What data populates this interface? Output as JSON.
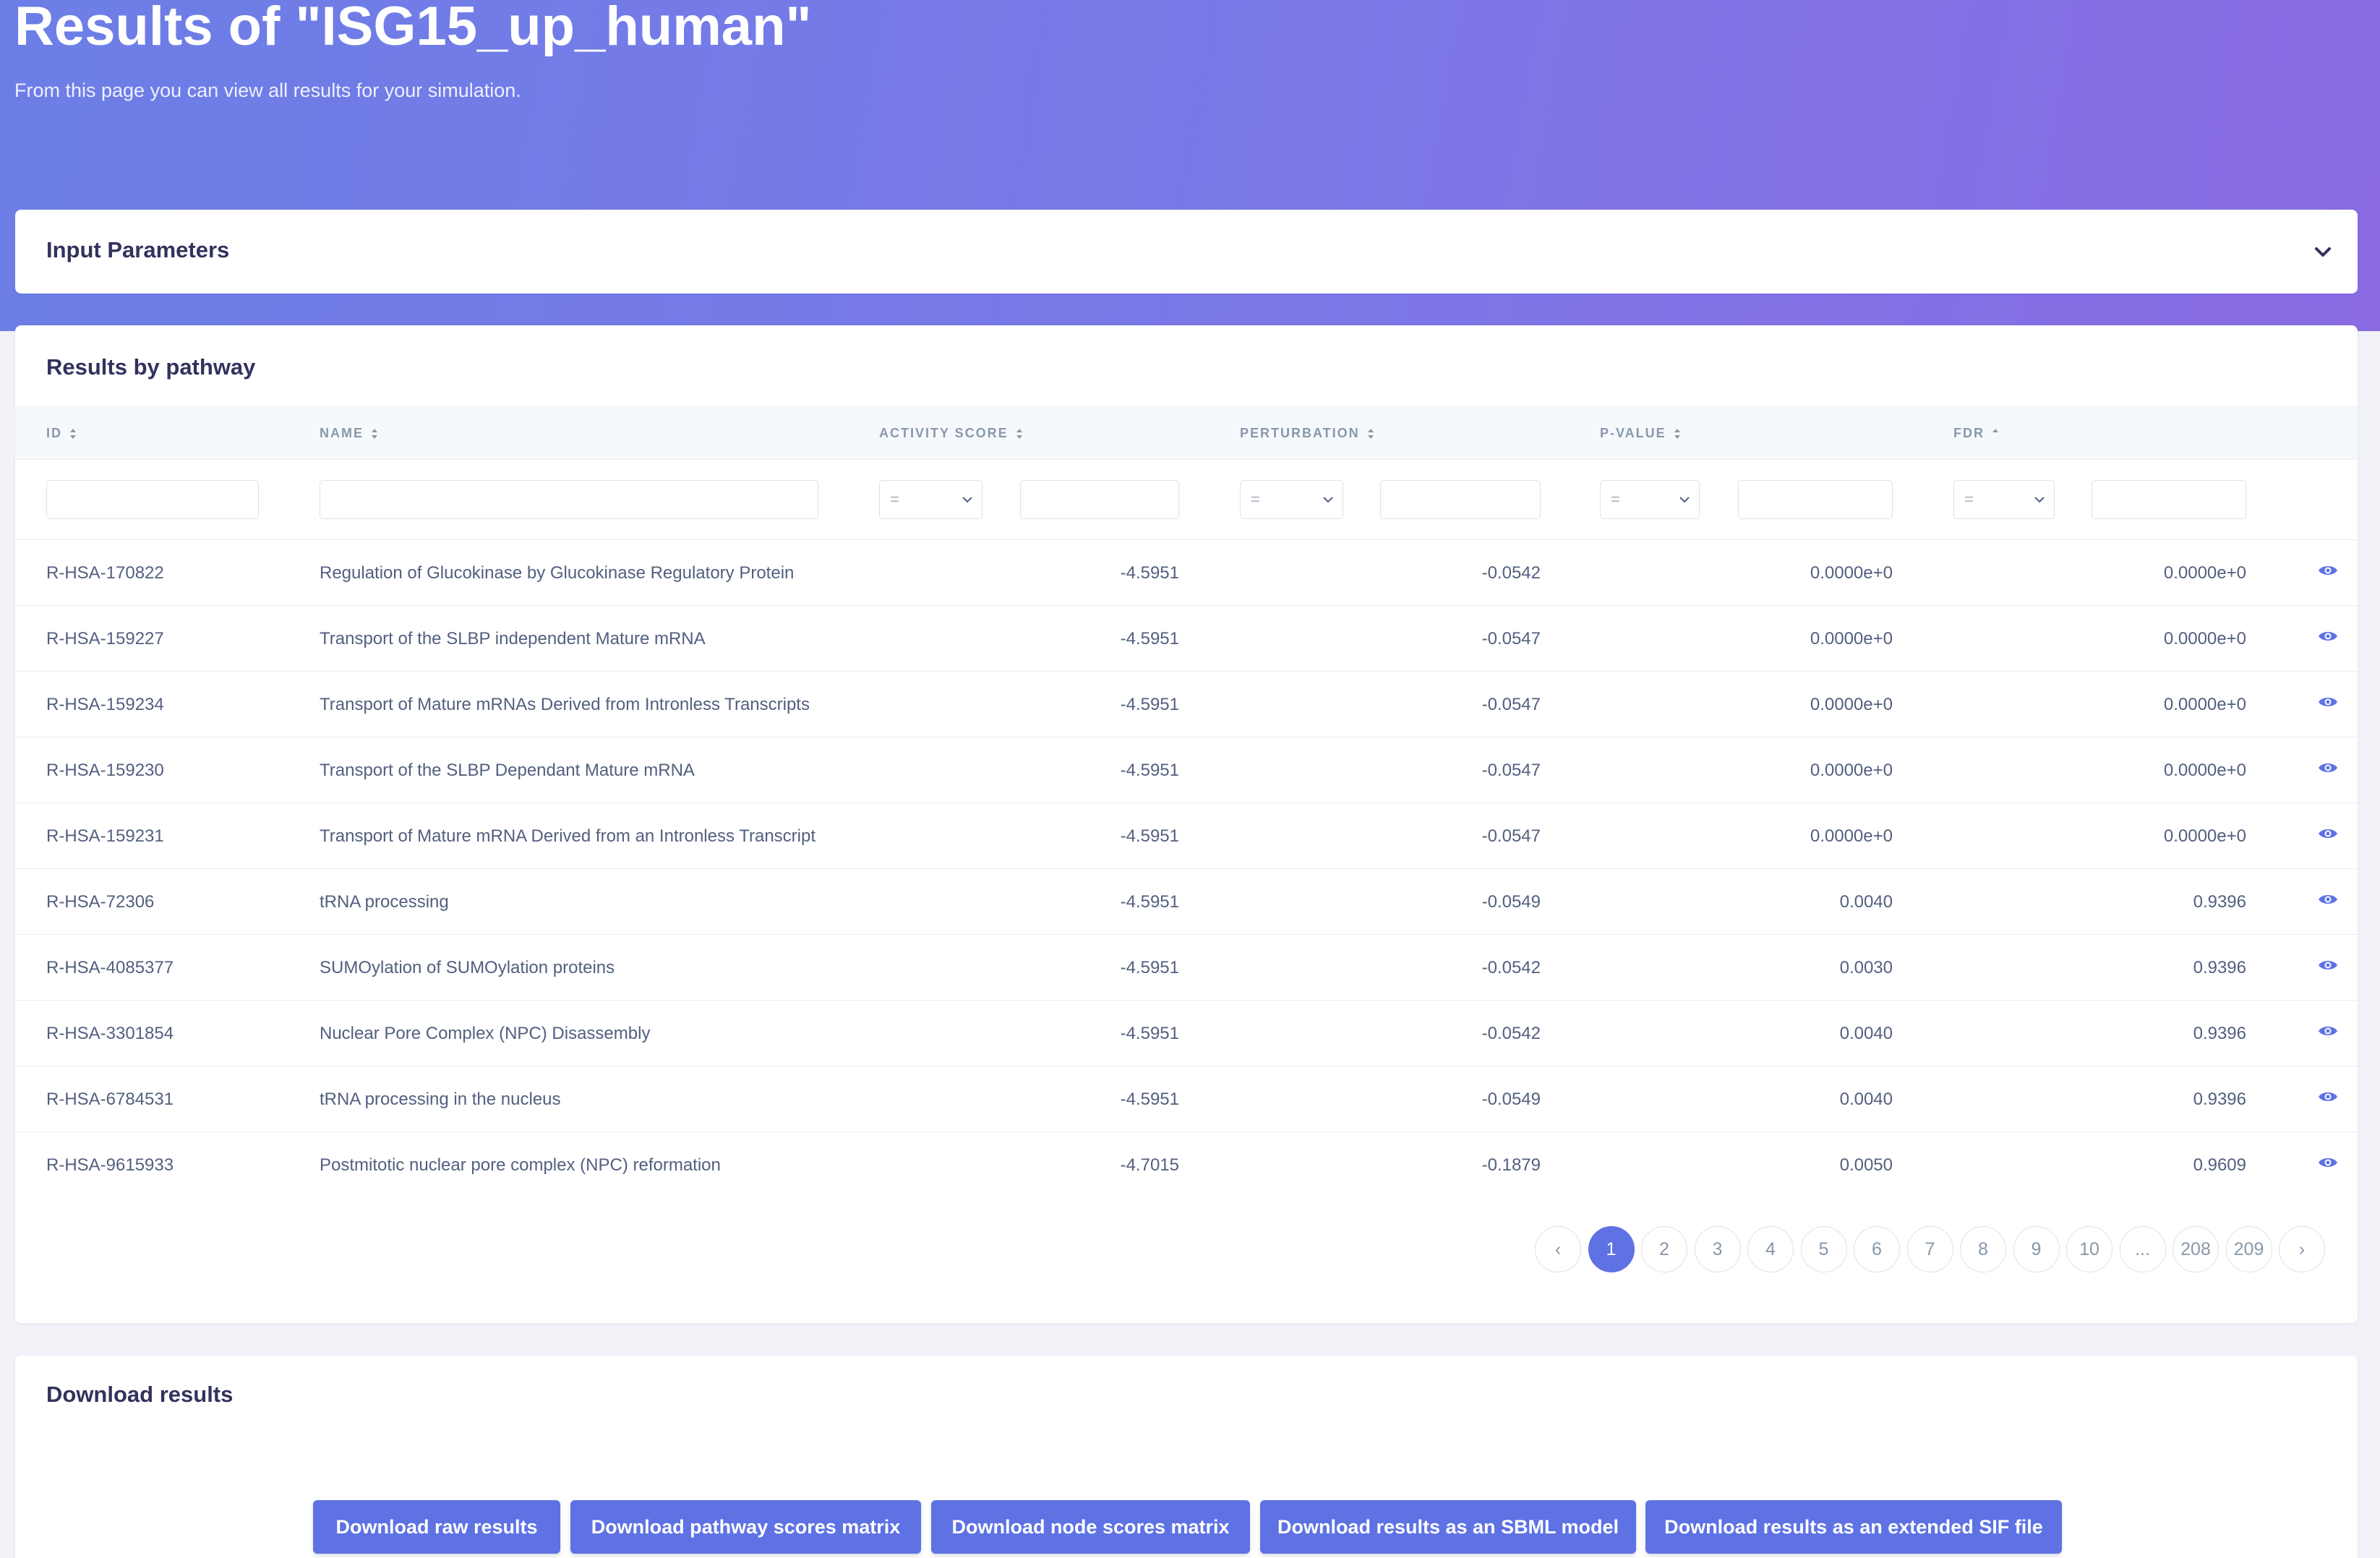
{
  "header": {
    "title": "Results of \"ISG15_up_human\"",
    "subtitle": "From this page you can view all results for your simulation."
  },
  "input_parameters": {
    "title": "Input Parameters",
    "icon": "chevron-down-icon"
  },
  "results": {
    "title": "Results by pathway",
    "columns": {
      "id": "ID",
      "name": "NAME",
      "activity": "ACTIVITY SCORE",
      "perturbation": "PERTURBATION",
      "pvalue": "P-VALUE",
      "fdr": "FDR"
    },
    "filters": {
      "activity_op": "=",
      "perturbation_op": "=",
      "pvalue_op": "=",
      "fdr_op": "="
    },
    "rows": [
      {
        "id": "R-HSA-170822",
        "name": "Regulation of Glucokinase by Glucokinase Regulatory Protein",
        "activity": "-4.5951",
        "perturbation": "-0.0542",
        "pvalue": "0.0000e+0",
        "fdr": "0.0000e+0"
      },
      {
        "id": "R-HSA-159227",
        "name": "Transport of the SLBP independent Mature mRNA",
        "activity": "-4.5951",
        "perturbation": "-0.0547",
        "pvalue": "0.0000e+0",
        "fdr": "0.0000e+0"
      },
      {
        "id": "R-HSA-159234",
        "name": "Transport of Mature mRNAs Derived from Intronless Transcripts",
        "activity": "-4.5951",
        "perturbation": "-0.0547",
        "pvalue": "0.0000e+0",
        "fdr": "0.0000e+0"
      },
      {
        "id": "R-HSA-159230",
        "name": "Transport of the SLBP Dependant Mature mRNA",
        "activity": "-4.5951",
        "perturbation": "-0.0547",
        "pvalue": "0.0000e+0",
        "fdr": "0.0000e+0"
      },
      {
        "id": "R-HSA-159231",
        "name": "Transport of Mature mRNA Derived from an Intronless Transcript",
        "activity": "-4.5951",
        "perturbation": "-0.0547",
        "pvalue": "0.0000e+0",
        "fdr": "0.0000e+0"
      },
      {
        "id": "R-HSA-72306",
        "name": "tRNA processing",
        "activity": "-4.5951",
        "perturbation": "-0.0549",
        "pvalue": "0.0040",
        "fdr": "0.9396"
      },
      {
        "id": "R-HSA-4085377",
        "name": "SUMOylation of SUMOylation proteins",
        "activity": "-4.5951",
        "perturbation": "-0.0542",
        "pvalue": "0.0030",
        "fdr": "0.9396"
      },
      {
        "id": "R-HSA-3301854",
        "name": "Nuclear Pore Complex (NPC) Disassembly",
        "activity": "-4.5951",
        "perturbation": "-0.0542",
        "pvalue": "0.0040",
        "fdr": "0.9396"
      },
      {
        "id": "R-HSA-6784531",
        "name": "tRNA processing in the nucleus",
        "activity": "-4.5951",
        "perturbation": "-0.0549",
        "pvalue": "0.0040",
        "fdr": "0.9396"
      },
      {
        "id": "R-HSA-9615933",
        "name": "Postmitotic nuclear pore complex (NPC) reformation",
        "activity": "-4.7015",
        "perturbation": "-0.1879",
        "pvalue": "0.0050",
        "fdr": "0.9609"
      }
    ],
    "pagination": [
      "‹",
      "1",
      "2",
      "3",
      "4",
      "5",
      "6",
      "7",
      "8",
      "9",
      "10",
      "...",
      "208",
      "209",
      "›"
    ],
    "current_page": "1"
  },
  "download": {
    "title": "Download results",
    "buttons": [
      "Download raw results",
      "Download pathway scores matrix",
      "Download node scores matrix",
      "Download results as an SBML model",
      "Download results as an extended SIF file"
    ]
  },
  "colors": {
    "accent": "#5e72e4",
    "hero_start": "#6c7ee6",
    "hero_end": "#8a6be4"
  }
}
